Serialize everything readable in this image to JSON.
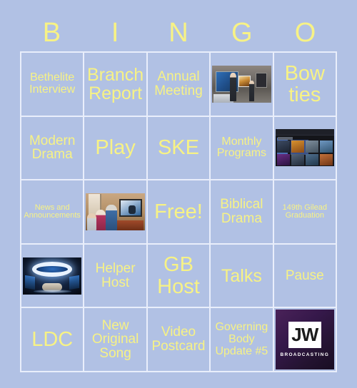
{
  "card": {
    "title": "BINGO",
    "header_letters": [
      "B",
      "I",
      "N",
      "G",
      "O"
    ],
    "text_color": "#f7f285",
    "background_color": "#b1c1e4",
    "grid_line_color": "#e9eefb"
  },
  "grid": {
    "columns": 5,
    "rows": 5,
    "cells": [
      {
        "label": "Bethelite Interview",
        "type": "text",
        "size": "sm"
      },
      {
        "label": "Branch Report",
        "type": "text",
        "size": "lg"
      },
      {
        "label": "Annual Meeting",
        "type": "text",
        "size": "md"
      },
      {
        "label": "",
        "type": "image",
        "image": "studio-presenters-image"
      },
      {
        "label": "Bow ties",
        "type": "text",
        "size": "xl"
      },
      {
        "label": "Modern Drama",
        "type": "text",
        "size": "md"
      },
      {
        "label": "Play",
        "type": "text",
        "size": "xl"
      },
      {
        "label": "SKE",
        "type": "text",
        "size": "xl"
      },
      {
        "label": "Monthly Programs",
        "type": "text",
        "size": "sm"
      },
      {
        "label": "",
        "type": "image",
        "image": "video-library-grid-image"
      },
      {
        "label": "News and Announcements",
        "type": "text",
        "size": "xs"
      },
      {
        "label": "",
        "type": "image",
        "image": "family-watching-tv-image"
      },
      {
        "label": "Free!",
        "type": "text",
        "size": "xl"
      },
      {
        "label": "Biblical Drama",
        "type": "text",
        "size": "md"
      },
      {
        "label": "149th Gilead Graduation",
        "type": "text",
        "size": "xs"
      },
      {
        "label": "",
        "type": "image",
        "image": "ring-studio-set-image"
      },
      {
        "label": "Helper Host",
        "type": "text",
        "size": "md"
      },
      {
        "label": "GB Host",
        "type": "text",
        "size": "xl"
      },
      {
        "label": "Talks",
        "type": "text",
        "size": "lg"
      },
      {
        "label": "Pause",
        "type": "text",
        "size": "md"
      },
      {
        "label": "LDC",
        "type": "text",
        "size": "xl"
      },
      {
        "label": "New Original Song",
        "type": "text",
        "size": "md"
      },
      {
        "label": "Video Postcard",
        "type": "text",
        "size": "md"
      },
      {
        "label": "Governing Body Update #5",
        "type": "text",
        "size": "sm"
      },
      {
        "label": "",
        "type": "image",
        "image": "jw-broadcasting-logo-image"
      }
    ]
  },
  "jw_logo": {
    "mark": "JW",
    "wordmark": "BROADCASTING"
  }
}
